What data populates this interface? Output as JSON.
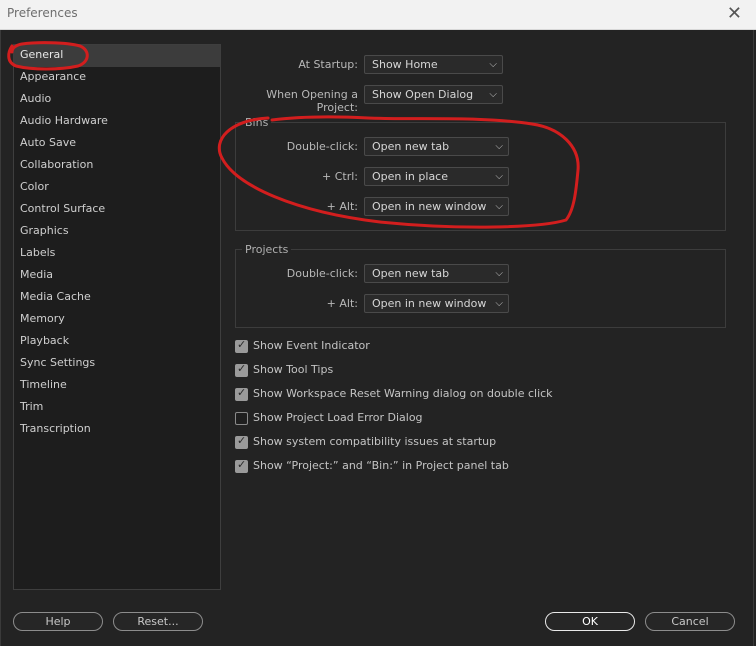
{
  "window": {
    "title": "Preferences",
    "close_glyph": "✕"
  },
  "sidebar": {
    "items": [
      {
        "label": "General",
        "selected": true
      },
      {
        "label": "Appearance"
      },
      {
        "label": "Audio"
      },
      {
        "label": "Audio Hardware"
      },
      {
        "label": "Auto Save"
      },
      {
        "label": "Collaboration"
      },
      {
        "label": "Color"
      },
      {
        "label": "Control Surface"
      },
      {
        "label": "Graphics"
      },
      {
        "label": "Labels"
      },
      {
        "label": "Media"
      },
      {
        "label": "Media Cache"
      },
      {
        "label": "Memory"
      },
      {
        "label": "Playback"
      },
      {
        "label": "Sync Settings"
      },
      {
        "label": "Timeline"
      },
      {
        "label": "Trim"
      },
      {
        "label": "Transcription"
      }
    ]
  },
  "general": {
    "at_startup": {
      "label": "At Startup:",
      "value": "Show Home"
    },
    "when_opening": {
      "label": "When Opening a Project:",
      "value": "Show Open Dialog"
    },
    "bins": {
      "title": "Bins",
      "double_click": {
        "label": "Double-click:",
        "value": "Open new tab"
      },
      "ctrl": {
        "label": "+ Ctrl:",
        "value": "Open in place"
      },
      "alt": {
        "label": "+ Alt:",
        "value": "Open in new window"
      }
    },
    "projects": {
      "title": "Projects",
      "double_click": {
        "label": "Double-click:",
        "value": "Open new tab"
      },
      "alt": {
        "label": "+ Alt:",
        "value": "Open in new window"
      }
    },
    "checkboxes": [
      {
        "label": "Show Event Indicator",
        "checked": true
      },
      {
        "label": "Show Tool Tips",
        "checked": true
      },
      {
        "label": "Show Workspace Reset Warning dialog on double click",
        "checked": true
      },
      {
        "label": "Show Project Load Error Dialog",
        "checked": false
      },
      {
        "label": "Show system compatibility issues at startup",
        "checked": true
      },
      {
        "label": "Show “Project:” and “Bin:” in Project panel tab",
        "checked": true
      }
    ]
  },
  "footer": {
    "help_label": "Help",
    "reset_label": "Reset...",
    "ok_label": "OK",
    "cancel_label": "Cancel"
  },
  "icons": {
    "dropdown": "chevron-down-icon",
    "checkbox_check": "checkmark-icon",
    "close": "close-icon"
  },
  "colors": {
    "annotation": "#d21e1e",
    "background": "#232323",
    "title_bar": "#f2f2f2"
  }
}
